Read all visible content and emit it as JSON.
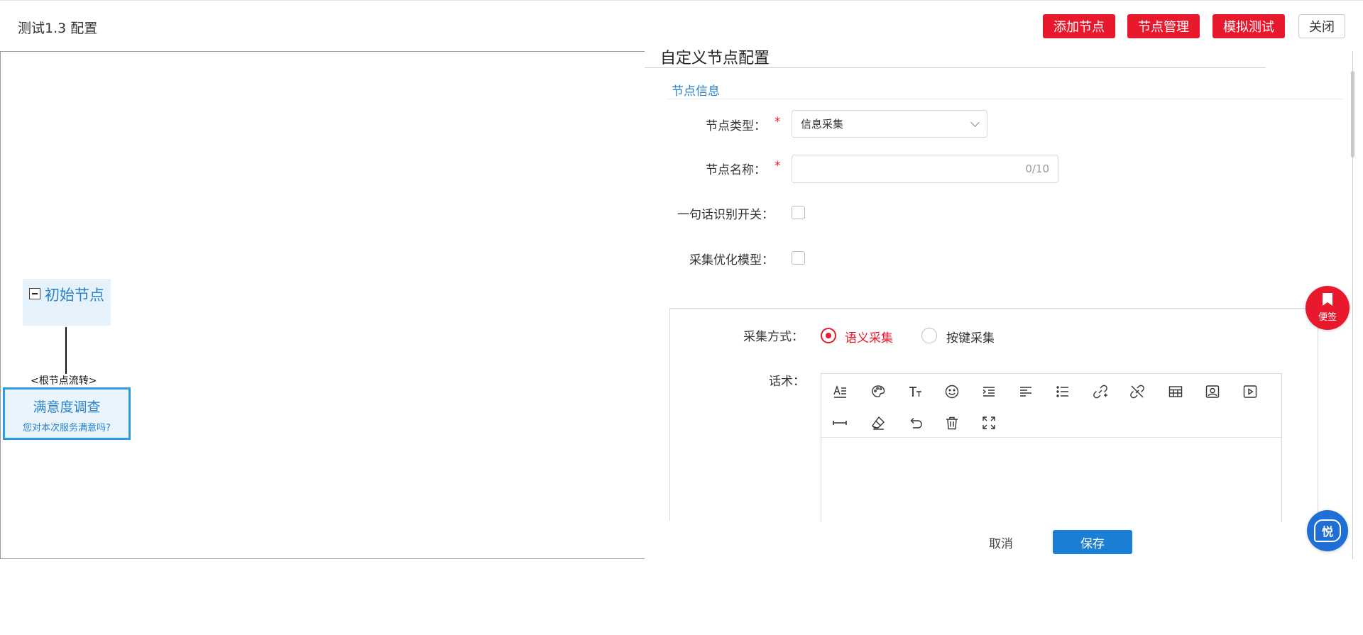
{
  "header": {
    "title": "测试1.3 配置",
    "buttons": {
      "add_node": "添加节点",
      "node_manage": "节点管理",
      "simulate_test": "模拟测试",
      "close": "关闭"
    }
  },
  "flow": {
    "root_node": {
      "label": "初始节点"
    },
    "edge_label": "<根节点流转>",
    "child_node": {
      "title": "满意度调查",
      "subtitle": "您对本次服务满意吗?"
    }
  },
  "panel": {
    "title": "自定义节点配置",
    "section_title": "节点信息",
    "fields": {
      "node_type": {
        "label": "节点类型：",
        "required": "*",
        "value": "信息采集"
      },
      "node_name": {
        "label": "节点名称：",
        "required": "*",
        "counter": "0/10"
      },
      "one_sentence_switch": {
        "label": "一句话识别开关：",
        "checked": false
      },
      "optimize_model": {
        "label": "采集优化模型：",
        "checked": false
      }
    },
    "collection": {
      "label": "采集方式：",
      "options": [
        {
          "label": "语义采集",
          "selected": true
        },
        {
          "label": "按键采集",
          "selected": false
        }
      ]
    },
    "script": {
      "label": "话术："
    },
    "toolbar_icons": [
      "font-format-icon",
      "palette-icon",
      "text-size-icon",
      "emoji-icon",
      "indent-icon",
      "align-icon",
      "list-icon",
      "link-icon",
      "unlink-icon",
      "table-icon",
      "image-icon",
      "video-icon",
      "horizontal-rule-icon",
      "eraser-icon",
      "undo-icon",
      "trash-icon",
      "fullscreen-icon"
    ],
    "actions": {
      "cancel": "取消",
      "save": "保存"
    }
  },
  "floating": {
    "note_label": "便签",
    "chat_label": "悦"
  },
  "colors": {
    "accent_red": "#e8192c",
    "accent_blue": "#1c7fd6",
    "node_blue": "#2b82c6"
  }
}
